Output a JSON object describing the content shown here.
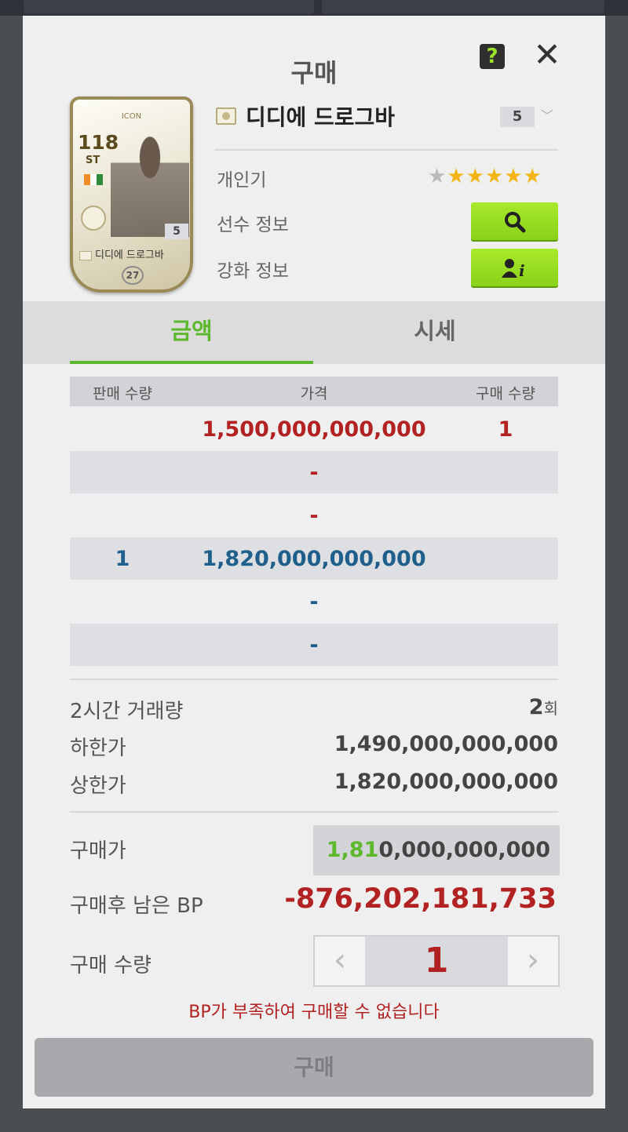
{
  "dialog": {
    "title": "구매",
    "help_icon": "question-mark-icon",
    "help_label": "?",
    "close_icon": "close-icon",
    "close_label": "✕"
  },
  "card": {
    "icon_label": "ICON",
    "overall": "118",
    "position": "ST",
    "grade": "5",
    "name": "디디에 드로그바",
    "season": "27"
  },
  "player": {
    "name": "디디에 드로그바",
    "grade_selected": "5",
    "grade_chevron": "﹀",
    "popularity_label": "개인기",
    "popularity_stars_filled": 5,
    "popularity_stars_total": 6,
    "info_label": "선수 정보",
    "info_icon": "search-icon",
    "enhance_label": "강화 정보",
    "enhance_icon": "user-info-icon"
  },
  "tabs": [
    {
      "label": "금액",
      "active": true
    },
    {
      "label": "시세",
      "active": false
    }
  ],
  "table": {
    "headers": {
      "sell_qty": "판매 수량",
      "price": "가격",
      "buy_qty": "구매 수량"
    },
    "rows": [
      {
        "sell_qty": "",
        "price": "1,500,000,000,000",
        "buy_qty": "1",
        "color": "red"
      },
      {
        "sell_qty": "",
        "price": "-",
        "buy_qty": "",
        "color": "red"
      },
      {
        "sell_qty": "",
        "price": "-",
        "buy_qty": "",
        "color": "red"
      },
      {
        "sell_qty": "1",
        "price": "1,820,000,000,000",
        "buy_qty": "",
        "color": "blue"
      },
      {
        "sell_qty": "",
        "price": "-",
        "buy_qty": "",
        "color": "blue"
      },
      {
        "sell_qty": "",
        "price": "-",
        "buy_qty": "",
        "color": "blue"
      }
    ]
  },
  "stats": {
    "volume_label": "2시간 거래량",
    "volume_value": "2",
    "volume_unit": "회",
    "lower_label": "하한가",
    "lower_value": "1,490,000,000,000",
    "upper_label": "상한가",
    "upper_value": "1,820,000,000,000"
  },
  "purchase": {
    "price_label": "구매가",
    "price_highlight": "1,81",
    "price_rest": "0,000,000,000",
    "remaining_label": "구매후 남은 BP",
    "remaining_value": "-876,202,181,733",
    "qty_label": "구매 수량",
    "qty_value": "1",
    "qty_minus": "‹",
    "qty_plus": "›",
    "warning": "BP가 부족하여 구매할 수 없습니다",
    "buy_button": "구매"
  },
  "colors": {
    "accent_green": "#5cb82d",
    "button_green": "#9ae024",
    "warning_red": "#b22222",
    "sell_blue": "#1f5f8b"
  }
}
